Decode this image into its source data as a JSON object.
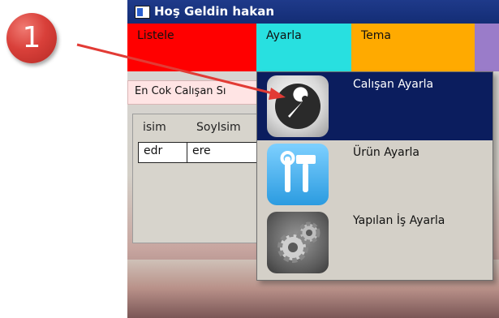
{
  "callout": {
    "number": "1",
    "color": "#d9403a"
  },
  "window": {
    "title": "Hoş Geldin  hakan",
    "app_icon": "window-icon"
  },
  "menu": {
    "items": [
      {
        "label": "Listele",
        "color": "#ff0000"
      },
      {
        "label": "Ayarla",
        "color": "#28e0e0"
      },
      {
        "label": "Tema",
        "color": "#ffaa00"
      }
    ]
  },
  "tab": {
    "label": "En Cok Calışan Sı"
  },
  "grid": {
    "columns": [
      "isim",
      "SoyIsim"
    ],
    "rows": [
      [
        "edr",
        "ere"
      ]
    ]
  },
  "dropdown": {
    "items": [
      {
        "label": "Calışan Ayarla",
        "icon": "wrench-icon",
        "selected": true
      },
      {
        "label": "Ürün Ayarla",
        "icon": "tools-icon"
      },
      {
        "label": "Yapılan İş Ayarla",
        "icon": "gears-icon"
      }
    ],
    "highlight_color": "#0b1d5e"
  }
}
